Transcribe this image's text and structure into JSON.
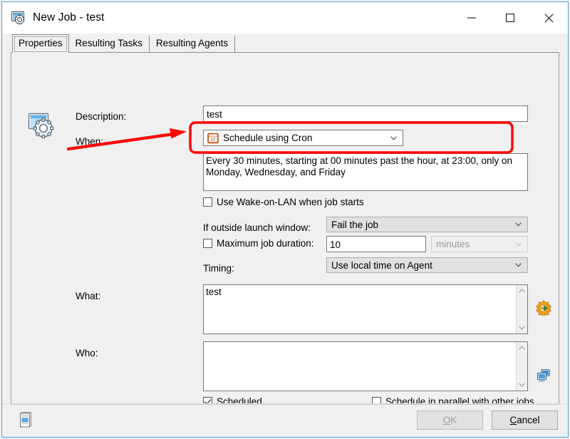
{
  "window": {
    "title": "New Job - test",
    "icon": "job-window-icon",
    "accent_color": "#4ca2dd",
    "caption": {
      "minimize": "minimize-icon",
      "maximize": "maximize-icon",
      "close": "close-icon"
    }
  },
  "tabs": [
    {
      "label": "Properties",
      "selected": true
    },
    {
      "label": "Resulting Tasks",
      "selected": false
    },
    {
      "label": "Resulting Agents",
      "selected": false
    }
  ],
  "form": {
    "description": {
      "label": "Description:",
      "value": "test",
      "placeholder": ""
    },
    "when": {
      "label": "When:",
      "value": "Schedule using Cron",
      "icon": "calendar-icon",
      "calendar_day": "12"
    },
    "cron_summary": {
      "value": "Every 30 minutes, starting at 00 minutes past the hour, at 23:00, only on Monday, Wednesday, and Friday"
    },
    "wake_on_lan": {
      "label": "Use Wake-on-LAN when job starts",
      "checked": false
    },
    "outside_window": {
      "label": "If outside launch window:",
      "value": "Fail the job"
    },
    "max_duration": {
      "label": "Maximum job duration:",
      "checked": false,
      "value": "10",
      "unit": "minutes",
      "unit_disabled": true
    },
    "timing": {
      "label": "Timing:",
      "value": "Use local time on Agent"
    },
    "what": {
      "label": "What:",
      "value": "test",
      "picker_icon": "task-picker-icon"
    },
    "who": {
      "label": "Who:",
      "value": "",
      "picker_icon": "agents-picker-icon"
    },
    "scheduled": {
      "label": "Scheduled",
      "checked": true
    },
    "parallel": {
      "label": "Schedule in parallel with other jobs",
      "checked": false
    }
  },
  "footer": {
    "status_icon": "windows-stack-icon",
    "ok": {
      "label": "OK",
      "accel": "O",
      "disabled": true
    },
    "cancel": {
      "label": "Cancel",
      "accel": "C",
      "disabled": false
    }
  },
  "annotation": {
    "color": "#ff0000",
    "shape": "arrow-and-rounded-rect",
    "target": "cron_summary"
  }
}
